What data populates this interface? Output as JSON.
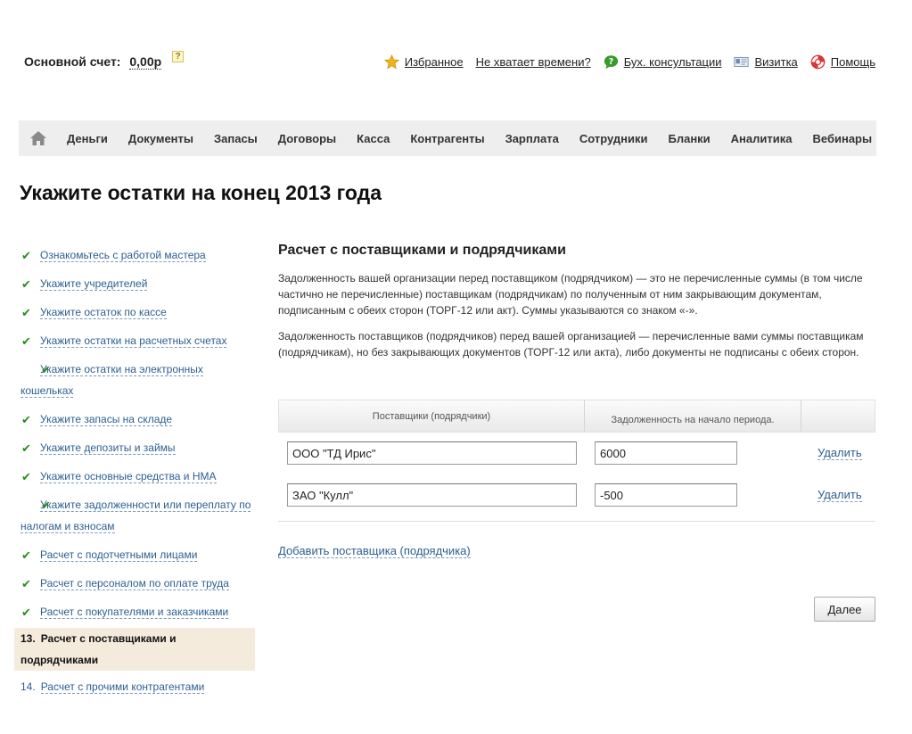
{
  "header": {
    "account_label": "Основной счет:",
    "account_amount": "0,00р",
    "help_badge": "?",
    "links": [
      {
        "label": "Избранное",
        "icon": "star-icon"
      },
      {
        "label": "Не хватает времени?",
        "icon": ""
      },
      {
        "label": "Бух. консультации",
        "icon": "chat-bubble-icon"
      },
      {
        "label": "Визитка",
        "icon": "business-card-icon"
      },
      {
        "label": "Помощь",
        "icon": "lifebuoy-icon"
      }
    ]
  },
  "nav": {
    "home_icon": "home-icon",
    "items": [
      "Деньги",
      "Документы",
      "Запасы",
      "Договоры",
      "Касса",
      "Контрагенты",
      "Зарплата",
      "Сотрудники",
      "Бланки",
      "Аналитика",
      "Вебинары"
    ]
  },
  "page_title": "Укажите остатки на конец 2013 года",
  "steps": [
    {
      "label": "Ознакомьтесь с работой мастера",
      "done": true
    },
    {
      "label": "Укажите учредителей",
      "done": true
    },
    {
      "label": "Укажите остаток по кассе",
      "done": true
    },
    {
      "label": "Укажите остатки на расчетных счетах",
      "done": true
    },
    {
      "label": "Укажите остатки на электронных кошельках",
      "done": true
    },
    {
      "label": "Укажите запасы на складе",
      "done": true
    },
    {
      "label": "Укажите депозиты и займы",
      "done": true
    },
    {
      "label": "Укажите основные средства и НМА",
      "done": true
    },
    {
      "label": "Укажите задолженности или переплату по налогам и взносам",
      "done": true
    },
    {
      "label": "Расчет с подотчетными лицами",
      "done": true
    },
    {
      "label": "Расчет с персоналом по оплате труда",
      "done": true
    },
    {
      "label": "Расчет с покупателями и заказчиками",
      "done": true
    },
    {
      "num": "13.",
      "label": "Расчет с поставщиками и подрядчиками",
      "active": true
    },
    {
      "num": "14.",
      "label": "Расчет с прочими контрагентами"
    }
  ],
  "main": {
    "title": "Расчет с поставщиками и подрядчиками",
    "para1": "Задолженность вашей организации перед поставщиком (подрядчиком) — это не перечисленные суммы (в том числе частично не перечисленные) поставщикам (подрядчикам) по полученным от ним закрывающим документам, подписанным с обеих сторон (ТОРГ-12 или акт). Суммы указываются со знаком «-».",
    "para2": "Задолженность поставщиков (подрядчиков) перед вашей организацией — перечисленные вами суммы поставщикам (подрядчикам), но без закрывающих документов (ТОРГ-12 или акта), либо документы не подписаны с обеих сторон.",
    "table": {
      "col_supplier": "Поставщики (подрядчики)",
      "col_debt": "Задолженность на начало периода.",
      "rows": [
        {
          "supplier": "ООО \"ТД Ирис\"",
          "debt": "6000",
          "delete": "Удалить"
        },
        {
          "supplier": "ЗАО \"Кулл\"",
          "debt": "-500",
          "delete": "Удалить"
        }
      ]
    },
    "add_link": "Добавить поставщика (подрядчика)",
    "next_button": "Далее"
  },
  "colors": {
    "link": "#2c5f91",
    "check": "#2a8a1e",
    "active_step_bg": "#f4ebdd",
    "nav_bg": "#eeeeee"
  }
}
